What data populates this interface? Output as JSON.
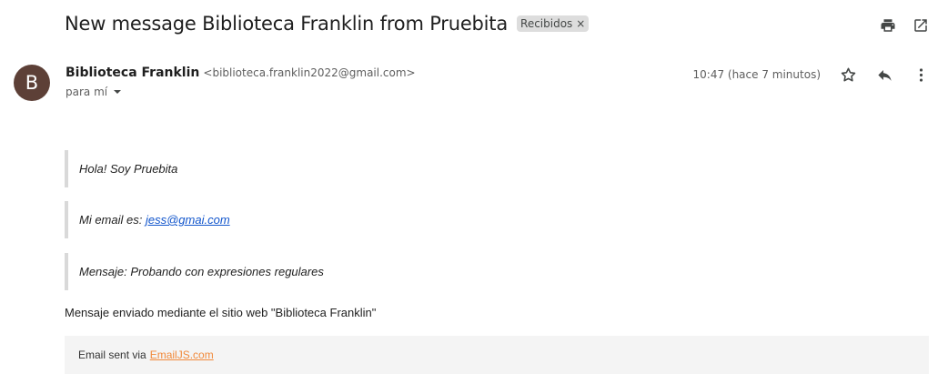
{
  "email": {
    "subject": "New message Biblioteca Franklin from Pruebita",
    "label": "Recibidos",
    "label_close": "×"
  },
  "sender": {
    "avatar_letter": "B",
    "name": "Biblioteca Franklin",
    "email": "<biblioteca.franklin2022@gmail.com>",
    "recipient": "para mí",
    "timestamp": "10:47 (hace 7 minutos)"
  },
  "body": {
    "line1": "Hola! Soy Pruebita",
    "line2_prefix": "Mi email es:",
    "line2_link": "jess@gmai.com",
    "line3": "Mensaje: Probando con expresiones regulares",
    "sent_note": "Mensaje enviado mediante el sitio web \"Biblioteca Franklin\"",
    "footer_prefix": "Email sent via",
    "footer_link": "EmailJS.com"
  },
  "icons": {
    "top": [
      "print-icon",
      "open-in-new-icon"
    ],
    "header": [
      "star-icon",
      "reply-icon",
      "more-vert-icon"
    ],
    "recipient": "caret-down-icon"
  },
  "colors": {
    "avatar": "#5d4037",
    "link": "#1155cc",
    "footer_link": "#f18a3b",
    "footer_bg": "#f4f4f4"
  }
}
